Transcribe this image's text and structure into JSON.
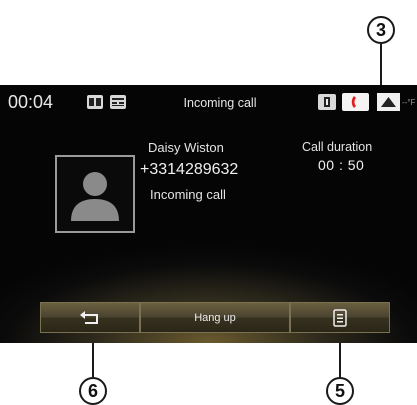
{
  "callouts": {
    "c3": "3",
    "c6": "6",
    "c5": "5"
  },
  "status_bar": {
    "time": "00:04",
    "title": "Incoming call",
    "left_icons": [
      "book-icon",
      "media-icon"
    ],
    "right_icons": [
      "notification-icon",
      "phone-icon",
      "signal-icon"
    ],
    "temp": "--°F"
  },
  "contact": {
    "name": "Daisy Wiston",
    "number": "+3314289632",
    "status": "Incoming call"
  },
  "call": {
    "duration_label": "Call duration",
    "duration_value": "00 : 50"
  },
  "buttons": {
    "back_icon": "back-arrow-icon",
    "hangup_label": "Hang up",
    "menu_icon": "menu-list-icon"
  },
  "colors": {
    "accent_bar": "#4a4330",
    "screen_bg": "#0b0b0b",
    "phone_red": "#e02020"
  }
}
